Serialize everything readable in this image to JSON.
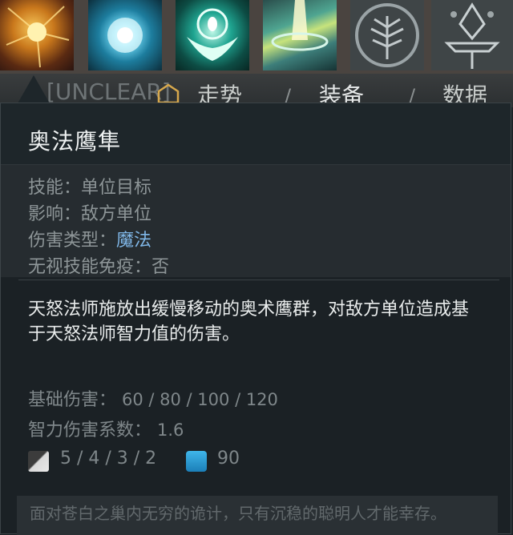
{
  "abilities": [
    {
      "icon": "sunburst-ability-icon"
    },
    {
      "icon": "arcane-orb-ability-icon"
    },
    {
      "icon": "winged-seal-ability-icon"
    },
    {
      "icon": "tornado-beam-ability-icon"
    },
    {
      "icon": "tree-talent-icon"
    },
    {
      "icon": "aghanim-scepter-icon"
    }
  ],
  "tabs": [
    {
      "label": "[UNCLEAR]"
    },
    {
      "label": "走势"
    },
    {
      "label": "装备"
    },
    {
      "label": "数据"
    }
  ],
  "tab_separator": "/",
  "tooltip": {
    "title": "奥法鹰隼",
    "stats": {
      "skill_label": "技能：",
      "skill_value": "单位目标",
      "affects_label": "影响：",
      "affects_value": "敌方单位",
      "damage_type_label": "伤害类型：",
      "damage_type_value": "魔法",
      "pierce_label": "无视技能免疫：",
      "pierce_value": "否"
    },
    "description": "天怒法师施放出缓慢移动的奥术鹰群，对敌方单位造成基于天怒法师智力值的伤害。",
    "base_damage_label": "基础伤害：",
    "base_damage_value": "60 / 80 / 100 / 120",
    "int_multiplier_label": "智力伤害系数：",
    "int_multiplier_value": "1.6",
    "cooldown_value": "5 / 4 / 3 / 2",
    "mana_cost_value": "90",
    "lore": "面对苍白之巢内无穷的诡计，只有沉稳的聪明人才能幸存。"
  },
  "colors": {
    "magic_damage": "#7fb6e6",
    "mana": "#2a9ad4",
    "background": "#1b2125"
  }
}
